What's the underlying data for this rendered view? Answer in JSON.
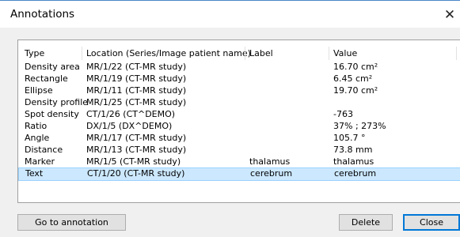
{
  "window": {
    "title": "Annotations",
    "close_glyph": "✕"
  },
  "columns": [
    "Type",
    "Location (Series/Image patient name)",
    "Label",
    "Value"
  ],
  "rows": [
    {
      "type": "Density area",
      "location": "MR/1/22  (CT-MR study)",
      "label": "",
      "value": "16.70 cm²"
    },
    {
      "type": "Rectangle",
      "location": "MR/1/19  (CT-MR study)",
      "label": "",
      "value": "6.45 cm²"
    },
    {
      "type": "Ellipse",
      "location": "MR/1/11  (CT-MR study)",
      "label": "",
      "value": "19.70 cm²"
    },
    {
      "type": "Density profile",
      "location": "MR/1/25  (CT-MR study)",
      "label": "",
      "value": ""
    },
    {
      "type": "Spot density",
      "location": "CT/1/26  (CT^DEMO)",
      "label": "",
      "value": "-763"
    },
    {
      "type": "Ratio",
      "location": "DX/1/5  (DX^DEMO)",
      "label": "",
      "value": "37% ; 273%"
    },
    {
      "type": "Angle",
      "location": "MR/1/17  (CT-MR study)",
      "label": "",
      "value": "105.7 °"
    },
    {
      "type": "Distance",
      "location": "MR/1/13  (CT-MR study)",
      "label": "",
      "value": "73.8 mm"
    },
    {
      "type": "Marker",
      "location": "MR/1/5  (CT-MR study)",
      "label": "thalamus",
      "value": "thalamus"
    },
    {
      "type": "Text",
      "location": "CT/1/20  (CT-MR study)",
      "label": "cerebrum",
      "value": "cerebrum",
      "selected": true
    }
  ],
  "buttons": {
    "goto": "Go to annotation",
    "delete": "Delete",
    "close": "Close"
  },
  "colors": {
    "selection_fill": "#cce8ff",
    "selection_border": "#99d1ff",
    "default_button_border": "#0078d7"
  },
  "icons": {
    "close": "close-icon"
  }
}
